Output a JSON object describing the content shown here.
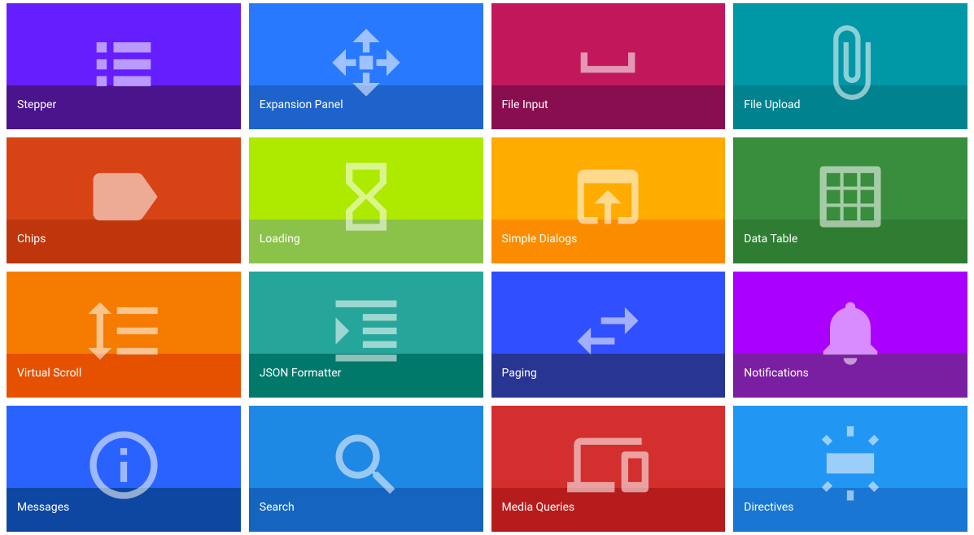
{
  "cards": [
    {
      "label": "Stepper",
      "colorTop": "#651fff",
      "colorBottom": "#4a148c",
      "icon": "list-icon"
    },
    {
      "label": "Expansion Panel",
      "colorTop": "#2979ff",
      "colorBottom": "#1e63cc",
      "icon": "expand-icon"
    },
    {
      "label": "File Input",
      "colorTop": "#c2185b",
      "colorBottom": "#880e4f",
      "icon": "space-bar-icon"
    },
    {
      "label": "File Upload",
      "colorTop": "#0097a7",
      "colorBottom": "#00838f",
      "icon": "attachment-icon"
    },
    {
      "label": "Chips",
      "colorTop": "#d84315",
      "colorBottom": "#bf360c",
      "icon": "label-icon"
    },
    {
      "label": "Loading",
      "colorTop": "#aeea00",
      "colorBottom": "#8bc34a",
      "icon": "hourglass-icon"
    },
    {
      "label": "Simple Dialogs",
      "colorTop": "#ffab00",
      "colorBottom": "#fb8c00",
      "icon": "open-in-browser-icon"
    },
    {
      "label": "Data Table",
      "colorTop": "#388e3c",
      "colorBottom": "#2e7d32",
      "icon": "grid-icon"
    },
    {
      "label": "Virtual Scroll",
      "colorTop": "#f57c00",
      "colorBottom": "#e65100",
      "icon": "line-spacing-icon"
    },
    {
      "label": "JSON Formatter",
      "colorTop": "#26a69a",
      "colorBottom": "#00796b",
      "icon": "indent-icon"
    },
    {
      "label": "Paging",
      "colorTop": "#304ffe",
      "colorBottom": "#283593",
      "icon": "swap-horiz-icon"
    },
    {
      "label": "Notifications",
      "colorTop": "#aa00ff",
      "colorBottom": "#7b1fa2",
      "icon": "bell-icon"
    },
    {
      "label": "Messages",
      "colorTop": "#2962ff",
      "colorBottom": "#0d47a1",
      "icon": "info-icon"
    },
    {
      "label": "Search",
      "colorTop": "#1e88e5",
      "colorBottom": "#1565c0",
      "icon": "search-icon"
    },
    {
      "label": "Media Queries",
      "colorTop": "#d32f2f",
      "colorBottom": "#b71c1c",
      "icon": "devices-icon"
    },
    {
      "label": "Directives",
      "colorTop": "#2196f3",
      "colorBottom": "#1976d2",
      "icon": "wb-iridescent-icon"
    }
  ]
}
